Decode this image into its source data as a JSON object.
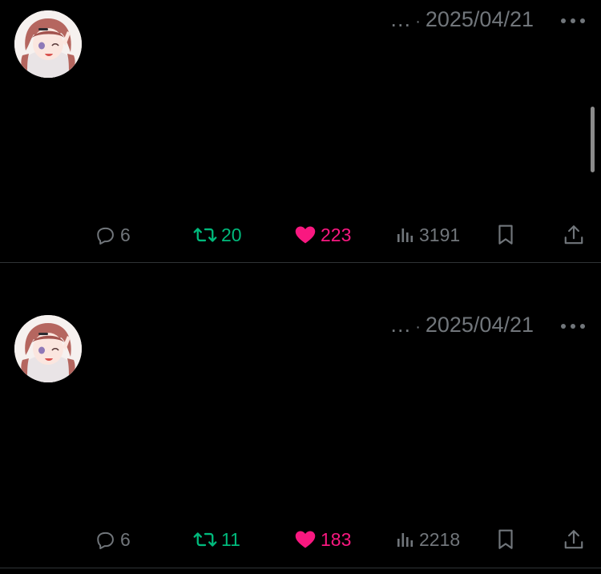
{
  "colors": {
    "background": "#000000",
    "muted": "#71767b",
    "retweet": "#00ba7c",
    "like": "#f91880",
    "divider": "#2f3336"
  },
  "tweets": [
    {
      "date": "2025/04/21",
      "ellipsis": "…",
      "separator": "·",
      "reply_count": "6",
      "retweet_count": "20",
      "like_count": "223",
      "view_count": "3191",
      "liked": true,
      "icons": {
        "more": "more-horizontal-icon",
        "reply": "reply-bubble-icon",
        "retweet": "retweet-icon",
        "like": "heart-filled-icon",
        "views": "analytics-bars-icon",
        "bookmark": "bookmark-icon",
        "share": "share-upload-icon"
      }
    },
    {
      "date": "2025/04/21",
      "ellipsis": "…",
      "separator": "·",
      "reply_count": "6",
      "retweet_count": "11",
      "like_count": "183",
      "view_count": "2218",
      "liked": true,
      "icons": {
        "more": "more-horizontal-icon",
        "reply": "reply-bubble-icon",
        "retweet": "retweet-icon",
        "like": "heart-filled-icon",
        "views": "analytics-bars-icon",
        "bookmark": "bookmark-icon",
        "share": "share-upload-icon"
      }
    }
  ]
}
